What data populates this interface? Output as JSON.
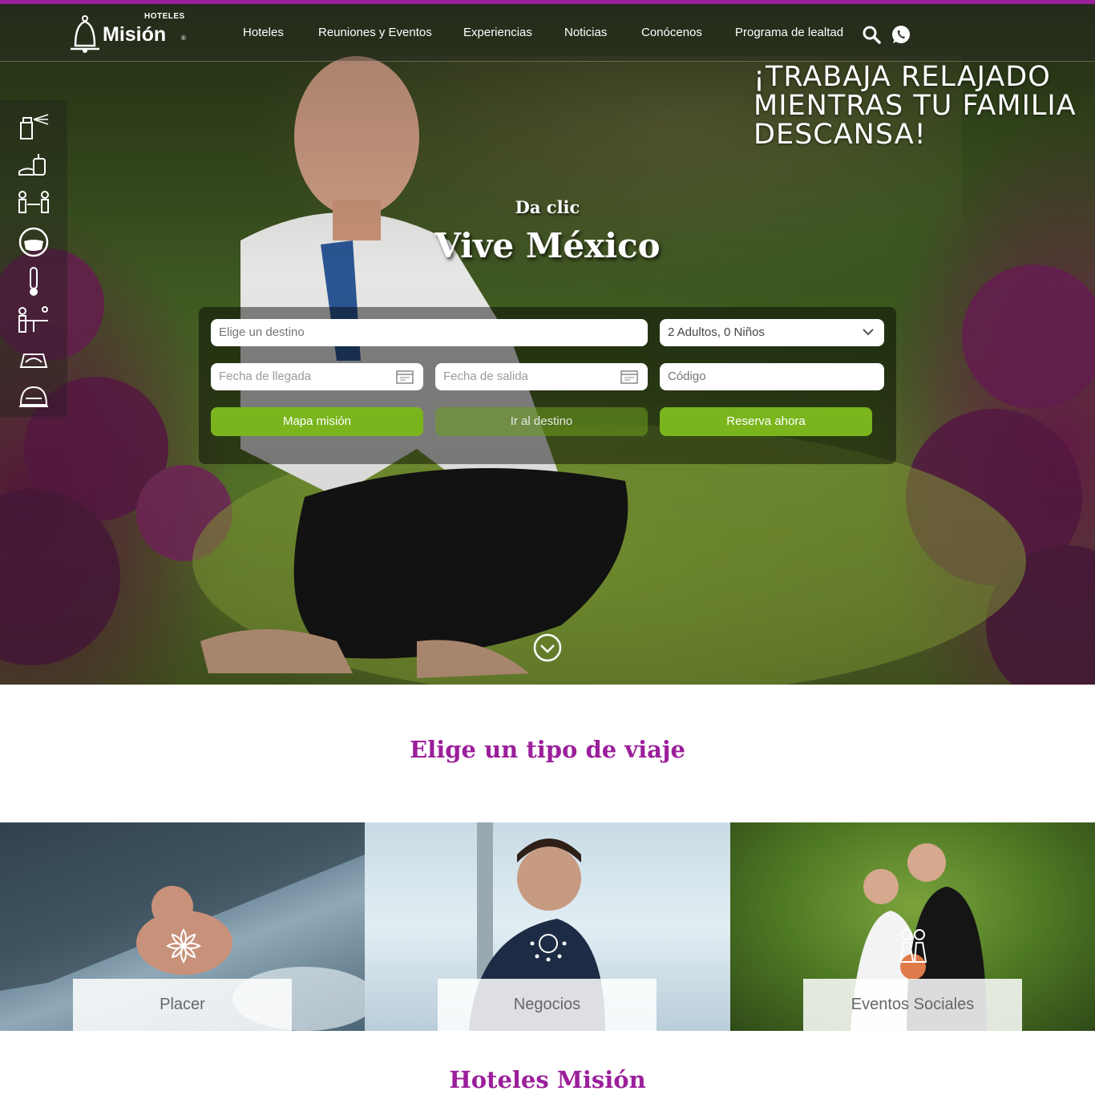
{
  "brand": {
    "top_word": "HOTELES",
    "name": "Misión",
    "reg": "®"
  },
  "nav": {
    "items": [
      {
        "label": "Hoteles"
      },
      {
        "label": "Reuniones y Eventos"
      },
      {
        "label": "Experiencias"
      },
      {
        "label": "Noticias"
      },
      {
        "label": "Conócenos"
      },
      {
        "label": "Programa de lealtad"
      }
    ],
    "icons": [
      "search-icon",
      "whatsapp-icon"
    ]
  },
  "sidebar": {
    "icons": [
      "sanitizer-spray-icon",
      "hand-wash-icon",
      "social-distance-icon",
      "face-mask-icon",
      "thermometer-icon",
      "table-distance-icon",
      "disinfected-bed-icon",
      "covered-food-icon"
    ]
  },
  "hero": {
    "tagline": [
      "¡TRABAJA RELAJADO",
      "MIENTRAS TU FAMILIA",
      "DESCANSA!"
    ],
    "subtitle": "Da clic",
    "title": "Vive México"
  },
  "booking": {
    "destination_placeholder": "Elige un destino",
    "guests_value": "2 Adultos,  0 Niños",
    "arrival_placeholder": "Fecha de llegada",
    "departure_placeholder": "Fecha de salida",
    "code_placeholder": "Código",
    "btn_map": "Mapa misión",
    "btn_destination": "Ir al destino",
    "btn_book": "Reserva ahora"
  },
  "trip_types": {
    "title": "Elige un tipo de viaje",
    "items": [
      {
        "label": "Placer"
      },
      {
        "label": "Negocios"
      },
      {
        "label": "Eventos Sociales"
      }
    ]
  },
  "hotels_section": {
    "title": "Hoteles Misión"
  },
  "colors": {
    "accent_purple": "#9b1f9a",
    "button_green": "#7ab51d"
  }
}
